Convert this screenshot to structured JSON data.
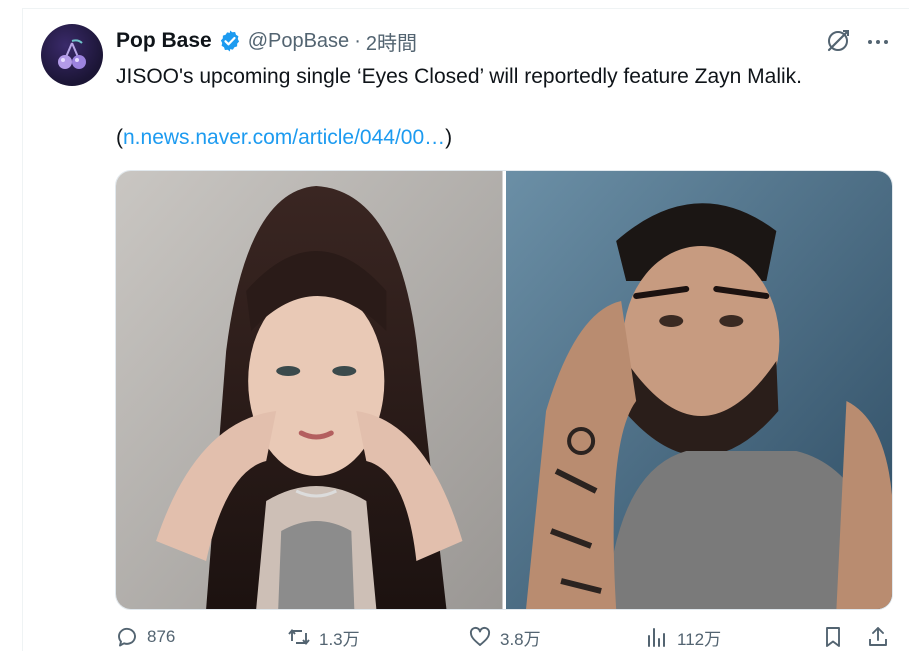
{
  "tweet": {
    "display_name": "Pop Base",
    "handle": "@PopBase",
    "separator": "·",
    "time": "2時間",
    "text": "JISOO's upcoming single ‘Eyes Closed’ will reportedly feature Zayn Malik.",
    "link_open": "(",
    "link_text": "n.news.naver.com/article/044/00…",
    "link_close": ")"
  },
  "icons": {
    "verified": "verified-badge-icon",
    "grok": "grok-icon",
    "more": "more-icon",
    "reply": "reply-icon",
    "retweet": "retweet-icon",
    "like": "like-icon",
    "views": "views-icon",
    "bookmark": "bookmark-icon",
    "share": "share-icon"
  },
  "colors": {
    "link": "#1d9bf0",
    "verified": "#1d9bf0",
    "muted": "#536471",
    "text": "#0f1419"
  },
  "actions": {
    "replies": "876",
    "retweets": "1.3万",
    "likes": "3.8万",
    "views": "112万"
  }
}
